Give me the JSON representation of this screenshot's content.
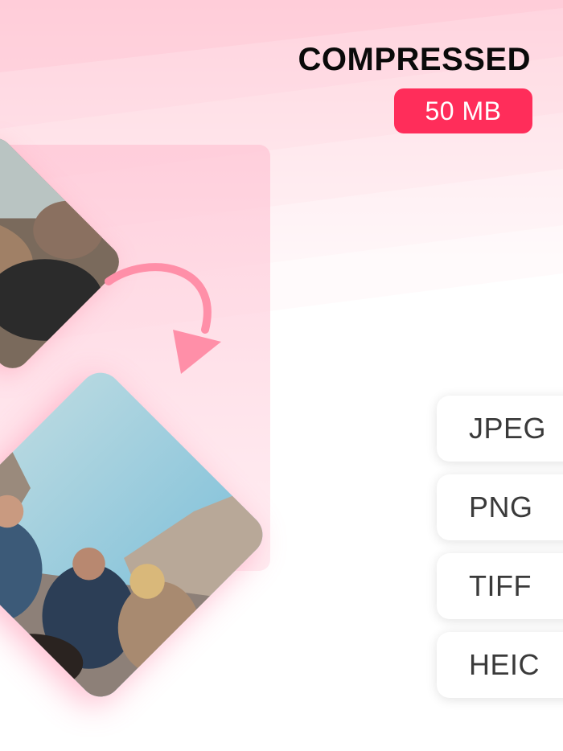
{
  "header": {
    "title": "COMPRESSED",
    "size_badge": "50 MB"
  },
  "formats": [
    {
      "label": "JPEG"
    },
    {
      "label": "PNG"
    },
    {
      "label": "TIFF"
    },
    {
      "label": "HEIC"
    }
  ],
  "colors": {
    "accent": "#ff2d5a",
    "panel_pink": "#ffc6d6",
    "arrow_pink": "#ff8fa8",
    "title_black": "#0a0a0a"
  },
  "icons": {
    "arrow": "curved-arrow-down-icon"
  },
  "images": {
    "before": "group-hikers-photo-small",
    "after": "group-hikers-photo-compressed"
  }
}
